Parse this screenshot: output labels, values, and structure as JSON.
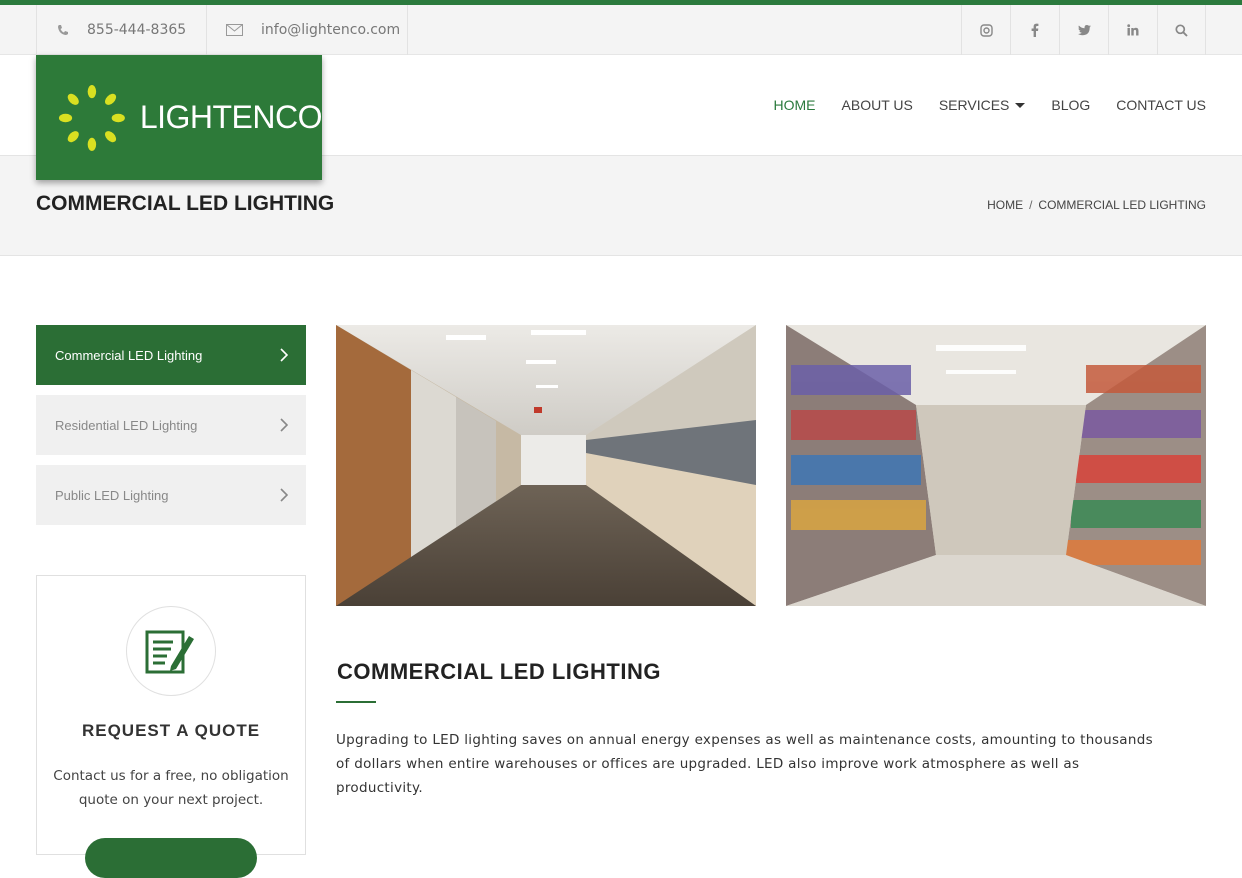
{
  "topbar": {
    "phone": "855-444-8365",
    "email": "info@lightenco.com",
    "socials": [
      {
        "icon": "instagram-icon",
        "glyph": "◎"
      },
      {
        "icon": "facebook-icon",
        "glyph": "f"
      },
      {
        "icon": "twitter-icon",
        "glyph": "t"
      },
      {
        "icon": "linkedin-icon",
        "glyph": "in"
      },
      {
        "icon": "search-icon",
        "glyph": ""
      }
    ]
  },
  "brand": {
    "name": "LIGHTENCO",
    "color": "#2d7a39",
    "logo_accent": "#d9e021"
  },
  "nav": {
    "home": "HOME",
    "about": "ABOUT US",
    "services": "SERVICES",
    "blog": "BLOG",
    "contact": "CONTACT US"
  },
  "page": {
    "title": "COMMERCIAL LED LIGHTING",
    "breadcrumb_home": "HOME",
    "breadcrumb_sep": "/",
    "breadcrumb_current": "COMMERCIAL LED LIGHTING"
  },
  "sidebar": {
    "items": [
      {
        "label": "Commercial LED Lighting",
        "active": true
      },
      {
        "label": "Residential LED Lighting",
        "active": false
      },
      {
        "label": "Public LED Lighting",
        "active": false
      }
    ]
  },
  "quote": {
    "title": "REQUEST A QUOTE",
    "text": "Contact us for a free, no obligation quote on your next project."
  },
  "content": {
    "title": "COMMERCIAL LED LIGHTING",
    "body": "Upgrading to LED lighting saves on annual energy expenses as well as maintenance costs, amounting to thousands of dollars when entire warehouses or offices are upgraded. LED also improve work atmosphere as well as productivity."
  },
  "colors": {
    "accent": "#2b7a3d",
    "active_bg": "#2b6e35"
  }
}
